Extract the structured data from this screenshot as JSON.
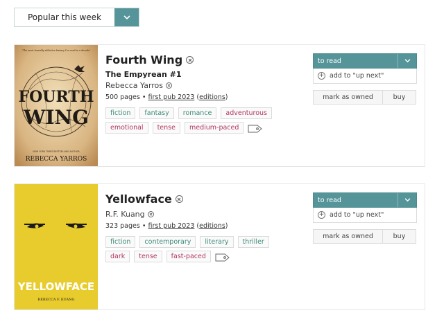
{
  "filter": {
    "label": "Popular this week"
  },
  "colors": {
    "accent": "#55959a",
    "mood_tag": "#3e8a78",
    "pace_tag": "#b1385f"
  },
  "books": [
    {
      "title": "Fourth Wing",
      "series": "The Empyrean #1",
      "author": "Rebecca Yarros",
      "pages": "500 pages",
      "pub": "first pub 2023",
      "editions": "editions",
      "tags": [
        {
          "label": "fiction",
          "kind": "green"
        },
        {
          "label": "fantasy",
          "kind": "green"
        },
        {
          "label": "romance",
          "kind": "green"
        },
        {
          "label": "adventurous",
          "kind": "pink"
        },
        {
          "label": "emotional",
          "kind": "pink"
        },
        {
          "label": "tense",
          "kind": "pink"
        },
        {
          "label": "medium-paced",
          "kind": "pink"
        }
      ],
      "cover": {
        "blurb": "\"The most formally addictive fantasy I've read in a decade\"",
        "title_top": "FOURTH",
        "title_bottom": "WING",
        "banner": "NEW YORK TIMES BESTSELLING AUTHOR",
        "author": "REBECCA YARROS"
      }
    },
    {
      "title": "Yellowface",
      "series": "",
      "author": "R.F. Kuang",
      "pages": "323 pages",
      "pub": "first pub 2023",
      "editions": "editions",
      "tags": [
        {
          "label": "fiction",
          "kind": "green"
        },
        {
          "label": "contemporary",
          "kind": "green"
        },
        {
          "label": "literary",
          "kind": "green"
        },
        {
          "label": "thriller",
          "kind": "green"
        },
        {
          "label": "dark",
          "kind": "pink"
        },
        {
          "label": "tense",
          "kind": "pink"
        },
        {
          "label": "fast-paced",
          "kind": "pink"
        }
      ],
      "cover": {
        "title": "YELLOWFACE",
        "author": "REBECCA F. KUANG"
      }
    }
  ],
  "actions": {
    "status": "to read",
    "up_next": "add to \"up next\"",
    "owned": "mark as owned",
    "buy": "buy"
  }
}
